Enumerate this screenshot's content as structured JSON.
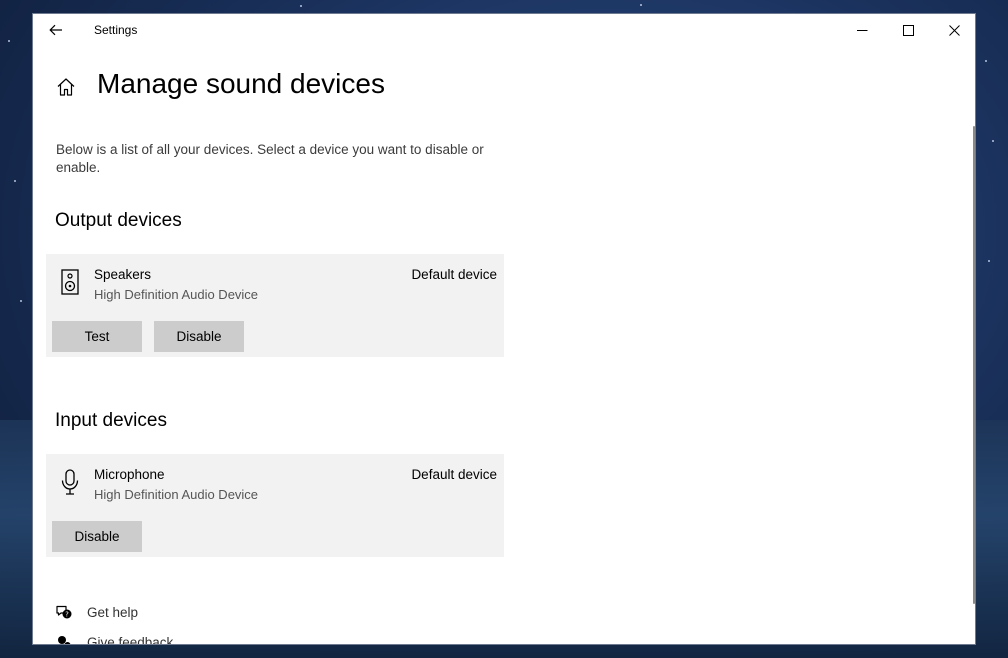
{
  "window": {
    "title": "Settings"
  },
  "page": {
    "title": "Manage sound devices",
    "intro": "Below is a list of all your devices. Select a device you want to disable or enable."
  },
  "output": {
    "heading": "Output devices",
    "device": {
      "icon": "speaker-icon",
      "name": "Speakers",
      "subtitle": "High Definition Audio Device",
      "status": "Default device",
      "test_label": "Test",
      "disable_label": "Disable"
    }
  },
  "input": {
    "heading": "Input devices",
    "device": {
      "icon": "microphone-icon",
      "name": "Microphone",
      "subtitle": "High Definition Audio Device",
      "status": "Default device",
      "disable_label": "Disable"
    }
  },
  "links": {
    "help": "Get help",
    "feedback": "Give feedback"
  },
  "colors": {
    "window_bg": "#ffffff",
    "card_bg": "#f2f2f2",
    "button_bg": "#cccccc"
  }
}
